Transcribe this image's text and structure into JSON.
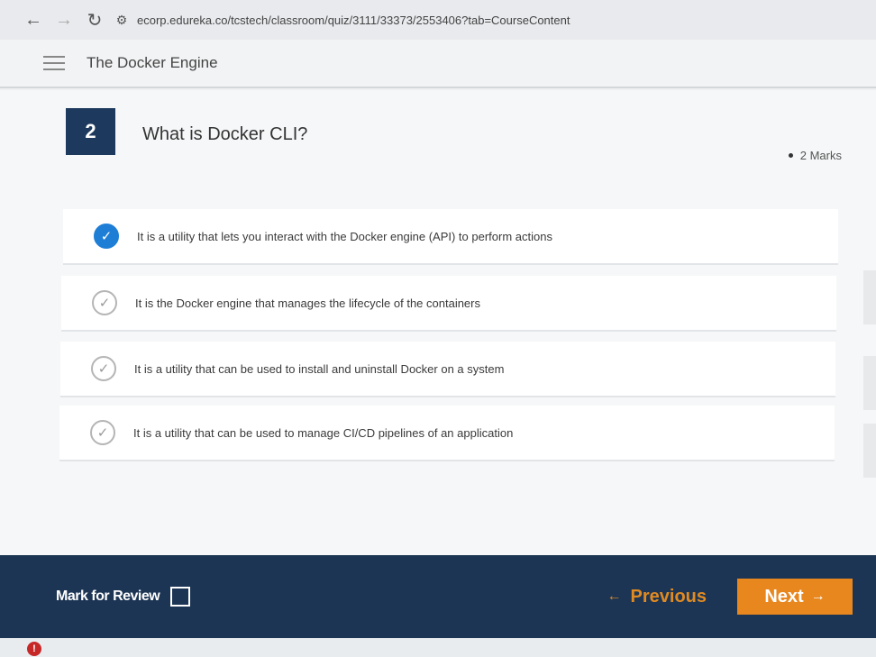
{
  "browser": {
    "url": "ecorp.edureka.co/tcstech/classroom/quiz/3111/33373/2553406?tab=CourseContent",
    "icons": {
      "back": "arrow-left-icon",
      "forward": "arrow-right-icon",
      "reload": "reload-icon",
      "site_info": "tune-icon"
    }
  },
  "header": {
    "course_title": "The Docker Engine"
  },
  "question": {
    "number": "2",
    "text": "What is Docker CLI?",
    "marks": "2 Marks"
  },
  "options": [
    {
      "text": "It is a utility that lets you interact with the Docker engine (API) to perform actions",
      "selected": true
    },
    {
      "text": "It is the Docker engine that manages the lifecycle of the containers",
      "selected": false
    },
    {
      "text": "It is a utility that can be used to install and uninstall Docker on a system",
      "selected": false
    },
    {
      "text": "It is a utility that can be used to manage CI/CD pipelines of an application",
      "selected": false
    }
  ],
  "footer": {
    "mark_for_review": "Mark for Review",
    "previous": "Previous",
    "next": "Next"
  },
  "colors": {
    "footer_bg": "#1c3554",
    "question_number_bg": "#1d3a5e",
    "accent_orange": "#e8871e",
    "selected_blue": "#1e7ed6"
  }
}
